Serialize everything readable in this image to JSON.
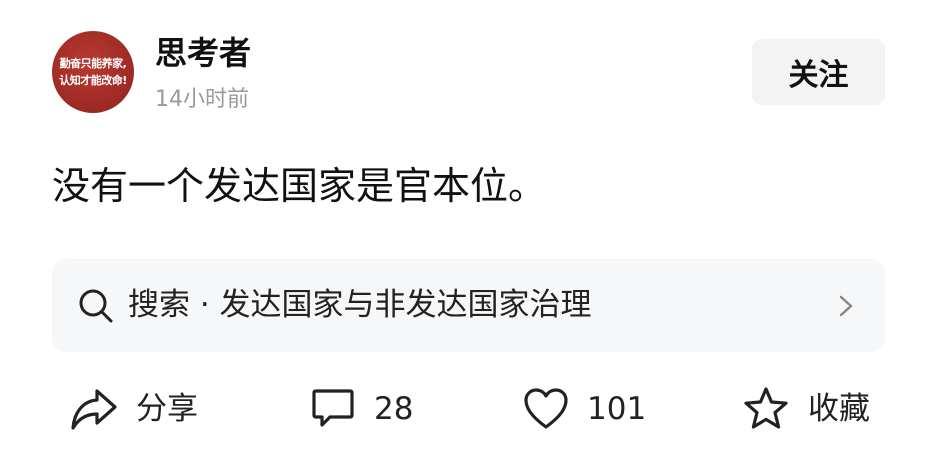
{
  "author": {
    "avatar_lines": [
      "勤奋只能养家,",
      "认知才能改命!"
    ],
    "name": "思考者",
    "time": "14小时前",
    "follow_label": "关注"
  },
  "post": {
    "text": "没有一个发达国家是官本位。"
  },
  "search_suggestion": {
    "text": "搜索 · 发达国家与非发达国家治理",
    "icon": "search-icon",
    "arrow_icon": "chevron-right-icon"
  },
  "actions": {
    "share": {
      "label": "分享",
      "icon": "share-icon"
    },
    "comment": {
      "count": "28",
      "icon": "comment-icon"
    },
    "like": {
      "count": "101",
      "icon": "heart-icon"
    },
    "favorite": {
      "label": "收藏",
      "icon": "star-icon"
    }
  },
  "colors": {
    "avatar_bg": "#9c2a24",
    "timestamp": "#9a9a9a",
    "follow_bg": "#f3f3f3",
    "search_bg": "#f6f7f9"
  }
}
